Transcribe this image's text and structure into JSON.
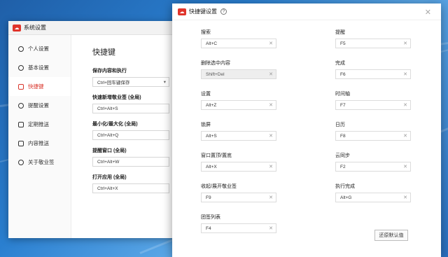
{
  "back_window": {
    "title": "系统设置",
    "sidebar": [
      {
        "label": "个人设置",
        "icon": "person-icon",
        "active": false
      },
      {
        "label": "基本设置",
        "icon": "target-icon",
        "active": false
      },
      {
        "label": "快捷键",
        "icon": "keyboard-icon",
        "active": true
      },
      {
        "label": "提醒设置",
        "icon": "bell-icon",
        "active": false
      },
      {
        "label": "定期推送",
        "icon": "calendar-icon",
        "active": false
      },
      {
        "label": "内容推送",
        "icon": "document-icon",
        "active": false
      },
      {
        "label": "关于敬业签",
        "icon": "info-icon",
        "active": false
      }
    ],
    "heading": "快捷键",
    "fields": [
      {
        "label": "保存内容和执行",
        "value": "Ctrl+回车键保存",
        "type": "select"
      },
      {
        "label": "快速新增敬业签 (全局)",
        "value": "Ctrl+Alt+S"
      },
      {
        "label": "最小化/最大化 (全局)",
        "value": "Ctrl+Alt+Q"
      },
      {
        "label": "提醒窗口 (全局)",
        "value": "Ctrl+Alt+W"
      },
      {
        "label": "打开应用 (全局)",
        "value": "Ctrl+Alt+X"
      }
    ]
  },
  "dialog": {
    "title": "快捷键设置",
    "help": "?",
    "close": "✕",
    "left": [
      {
        "label": "搜索",
        "value": "Alt+C",
        "disabled": false
      },
      {
        "label": "删除选中内容",
        "value": "Shift+Del",
        "disabled": true
      },
      {
        "label": "设置",
        "value": "Alt+Z",
        "disabled": false
      },
      {
        "label": "锁屏",
        "value": "Alt+S",
        "disabled": false
      },
      {
        "label": "窗口置顶/置底",
        "value": "Alt+X",
        "disabled": false
      },
      {
        "label": "收起/展开敬业签",
        "value": "F9",
        "disabled": false
      },
      {
        "label": "团签列表",
        "value": "F4",
        "disabled": false
      }
    ],
    "right": [
      {
        "label": "提醒",
        "value": "F5"
      },
      {
        "label": "完成",
        "value": "F6"
      },
      {
        "label": "时间轴",
        "value": "F7"
      },
      {
        "label": "日历",
        "value": "F8"
      },
      {
        "label": "云同步",
        "value": "F2"
      },
      {
        "label": "执行完成",
        "value": "Alt+G"
      }
    ],
    "restore_button": "还原默认值",
    "clear_glyph": "✕"
  },
  "colors": {
    "accent": "#d9362c",
    "desktop": "#2a7fd0"
  }
}
